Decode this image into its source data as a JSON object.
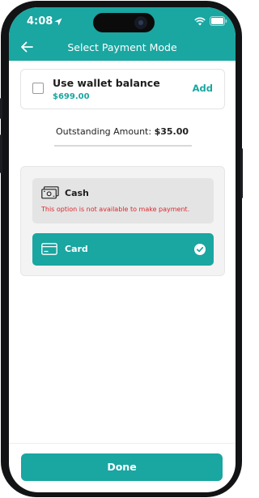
{
  "status_bar": {
    "time": "4:08",
    "icons": [
      "location-arrow-icon",
      "wifi-icon",
      "battery-icon"
    ]
  },
  "header": {
    "title": "Select Payment Mode",
    "back_icon": "arrow-left-icon"
  },
  "wallet": {
    "title": "Use wallet balance",
    "balance": "$699.00",
    "add_label": "Add",
    "checked": false
  },
  "outstanding": {
    "label": "Outstanding Amount:",
    "amount": "$35.00"
  },
  "payment_options": [
    {
      "label": "Cash",
      "icon": "cash-icon",
      "note": "This option is not available to make payment.",
      "enabled": false
    },
    {
      "label": "Card",
      "icon": "card-icon",
      "selected": true
    }
  ],
  "done_label": "Done",
  "colors": {
    "accent": "#1aa6a1",
    "error": "#e0262b",
    "disabled_bg": "#e4e4e4"
  }
}
